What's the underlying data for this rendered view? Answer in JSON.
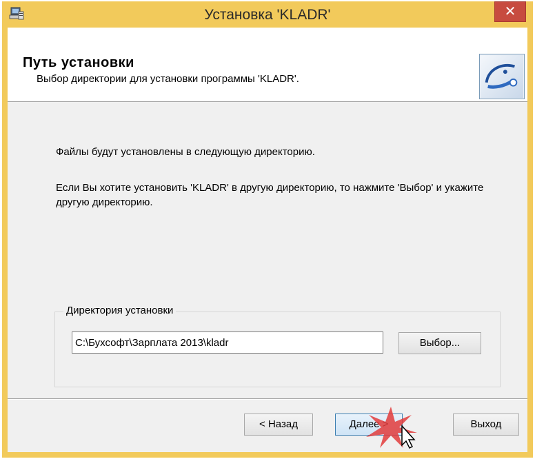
{
  "window": {
    "title": "Установка 'KLADR'",
    "close_glyph": "✕"
  },
  "header": {
    "title": "Путь установки",
    "subtitle": "Выбор директории для установки программы 'KLADR'."
  },
  "body": {
    "info_line1": "Файлы будут установлены в следующую директорию.",
    "info_line2": "Если Вы хотите установить 'KLADR' в другую директорию, то нажмите 'Выбор' и укажите другую директорию."
  },
  "install_dir": {
    "label": "Директория установки",
    "value": "C:\\Бухсофт\\Зарплата 2013\\kladr",
    "browse_label": "Выбор..."
  },
  "footer": {
    "back_label": "< Назад",
    "next_label": "Далее >",
    "exit_label": "Выход"
  },
  "colors": {
    "title_bar": "#f2ca5b",
    "close_button": "#c74b3f",
    "dialog_bg": "#f0f0f0",
    "accent_focus": "#3c7fb1"
  },
  "icons": {
    "app": "installer-computer-icon",
    "logo": "kladr-disc-logo",
    "close": "close-icon",
    "cursor": "mouse-pointer-icon"
  }
}
